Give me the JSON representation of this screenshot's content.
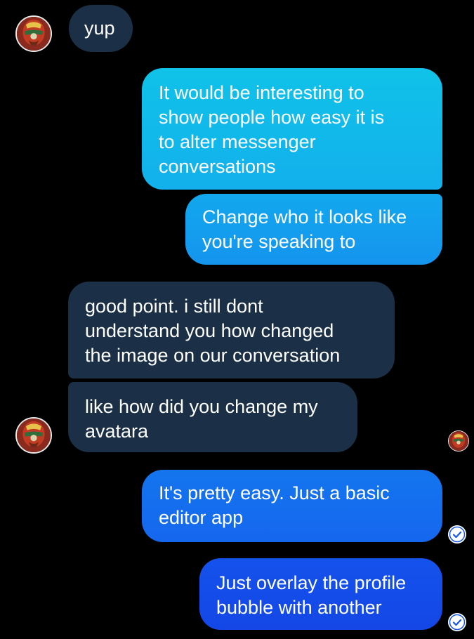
{
  "messages": [
    {
      "id": "m1",
      "direction": "received",
      "text": "yup"
    },
    {
      "id": "m2",
      "direction": "sent",
      "text": "It would be interesting to\nshow people how easy it is\nto alter messenger\nconversations"
    },
    {
      "id": "m3",
      "direction": "sent",
      "text": "Change who it looks like\nyou're speaking to"
    },
    {
      "id": "m4",
      "direction": "received",
      "text": "good point. i still dont\nunderstand you how changed\nthe image on our conversation"
    },
    {
      "id": "m5",
      "direction": "received",
      "text": "like how did you change my\navatara"
    },
    {
      "id": "m6",
      "direction": "sent",
      "text": "It's pretty easy. Just a basic\neditor app"
    },
    {
      "id": "m7",
      "direction": "sent",
      "text": "Just overlay the profile\nbubble with another"
    }
  ],
  "contact_avatar": {
    "icon": "hot-air-balloon-icon"
  },
  "seen_avatar": {
    "icon": "hot-air-balloon-icon"
  },
  "status": {
    "delivered_icon": "check-circle-icon"
  },
  "colors": {
    "background": "#000000",
    "received_bubble": "#1b3046",
    "sent_gradient_top": "#0fc1e8",
    "sent_gradient_bottom": "#1447e6",
    "check_color": "#1557e8"
  }
}
